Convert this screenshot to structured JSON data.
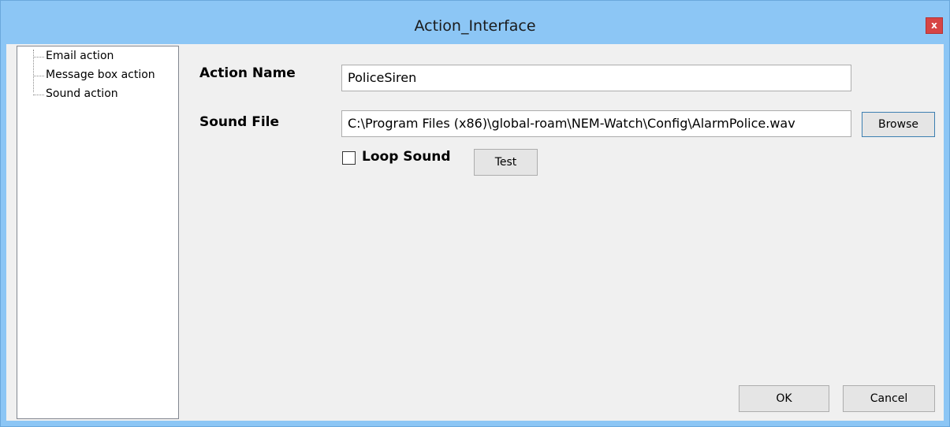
{
  "window": {
    "title": "Action_Interface",
    "close_glyph": "x"
  },
  "tree": {
    "items": [
      {
        "label": "Email action"
      },
      {
        "label": "Message box action"
      },
      {
        "label": "Sound action"
      }
    ]
  },
  "form": {
    "action_name_label": "Action Name",
    "action_name_value": "PoliceSiren",
    "sound_file_label": "Sound File",
    "sound_file_value": "C:\\Program Files (x86)\\global-roam\\NEM-Watch\\Config\\AlarmPolice.wav",
    "browse_label": "Browse",
    "loop_sound_label": "Loop Sound",
    "loop_sound_checked": false,
    "test_label": "Test"
  },
  "footer": {
    "ok_label": "OK",
    "cancel_label": "Cancel"
  }
}
